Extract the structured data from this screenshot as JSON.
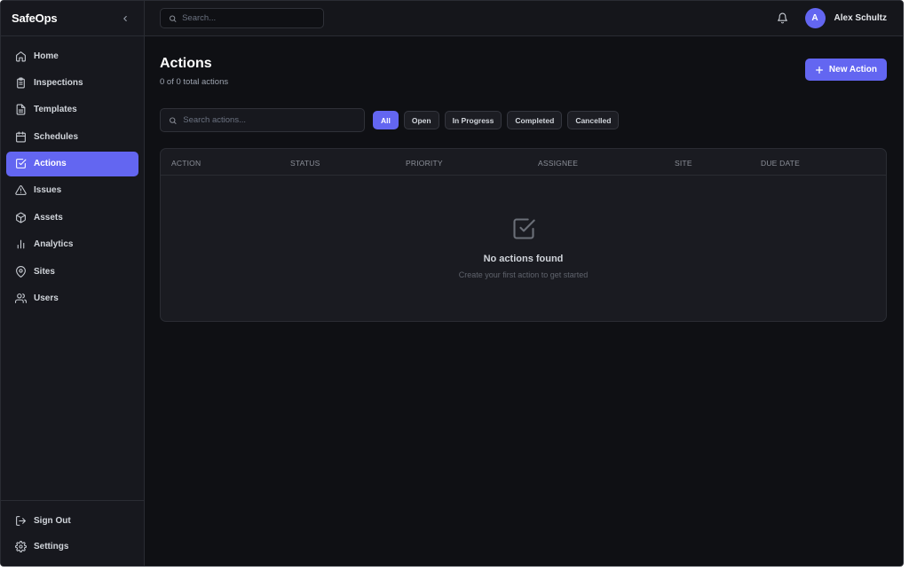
{
  "app": {
    "brand": "SafeOps"
  },
  "sidebar": {
    "items": [
      {
        "label": "Home",
        "icon": "home-icon"
      },
      {
        "label": "Inspections",
        "icon": "clipboard-icon"
      },
      {
        "label": "Templates",
        "icon": "file-text-icon"
      },
      {
        "label": "Schedules",
        "icon": "calendar-icon"
      },
      {
        "label": "Actions",
        "icon": "check-square-icon",
        "active": true
      },
      {
        "label": "Issues",
        "icon": "alert-triangle-icon"
      },
      {
        "label": "Assets",
        "icon": "box-icon"
      },
      {
        "label": "Analytics",
        "icon": "bar-chart-icon"
      },
      {
        "label": "Sites",
        "icon": "map-pin-icon"
      },
      {
        "label": "Users",
        "icon": "users-icon"
      }
    ],
    "footer": [
      {
        "label": "Sign Out",
        "icon": "sign-out-icon"
      },
      {
        "label": "Settings",
        "icon": "gear-icon"
      }
    ]
  },
  "topbar": {
    "search_placeholder": "Search...",
    "user": {
      "initial": "A",
      "name": "Alex Schultz"
    }
  },
  "page": {
    "title": "Actions",
    "subtitle": "0 of 0 total actions",
    "new_button": "New Action",
    "search_placeholder": "Search actions...",
    "filters": [
      {
        "label": "All",
        "active": true
      },
      {
        "label": "Open"
      },
      {
        "label": "In Progress"
      },
      {
        "label": "Completed"
      },
      {
        "label": "Cancelled"
      }
    ],
    "columns": [
      "ACTION",
      "STATUS",
      "PRIORITY",
      "ASSIGNEE",
      "SITE",
      "DUE DATE"
    ],
    "empty": {
      "title": "No actions found",
      "subtitle": "Create your first action to get started"
    }
  },
  "colors": {
    "accent": "#6366f1",
    "bg": "#0f1014",
    "panel": "#17181e"
  }
}
